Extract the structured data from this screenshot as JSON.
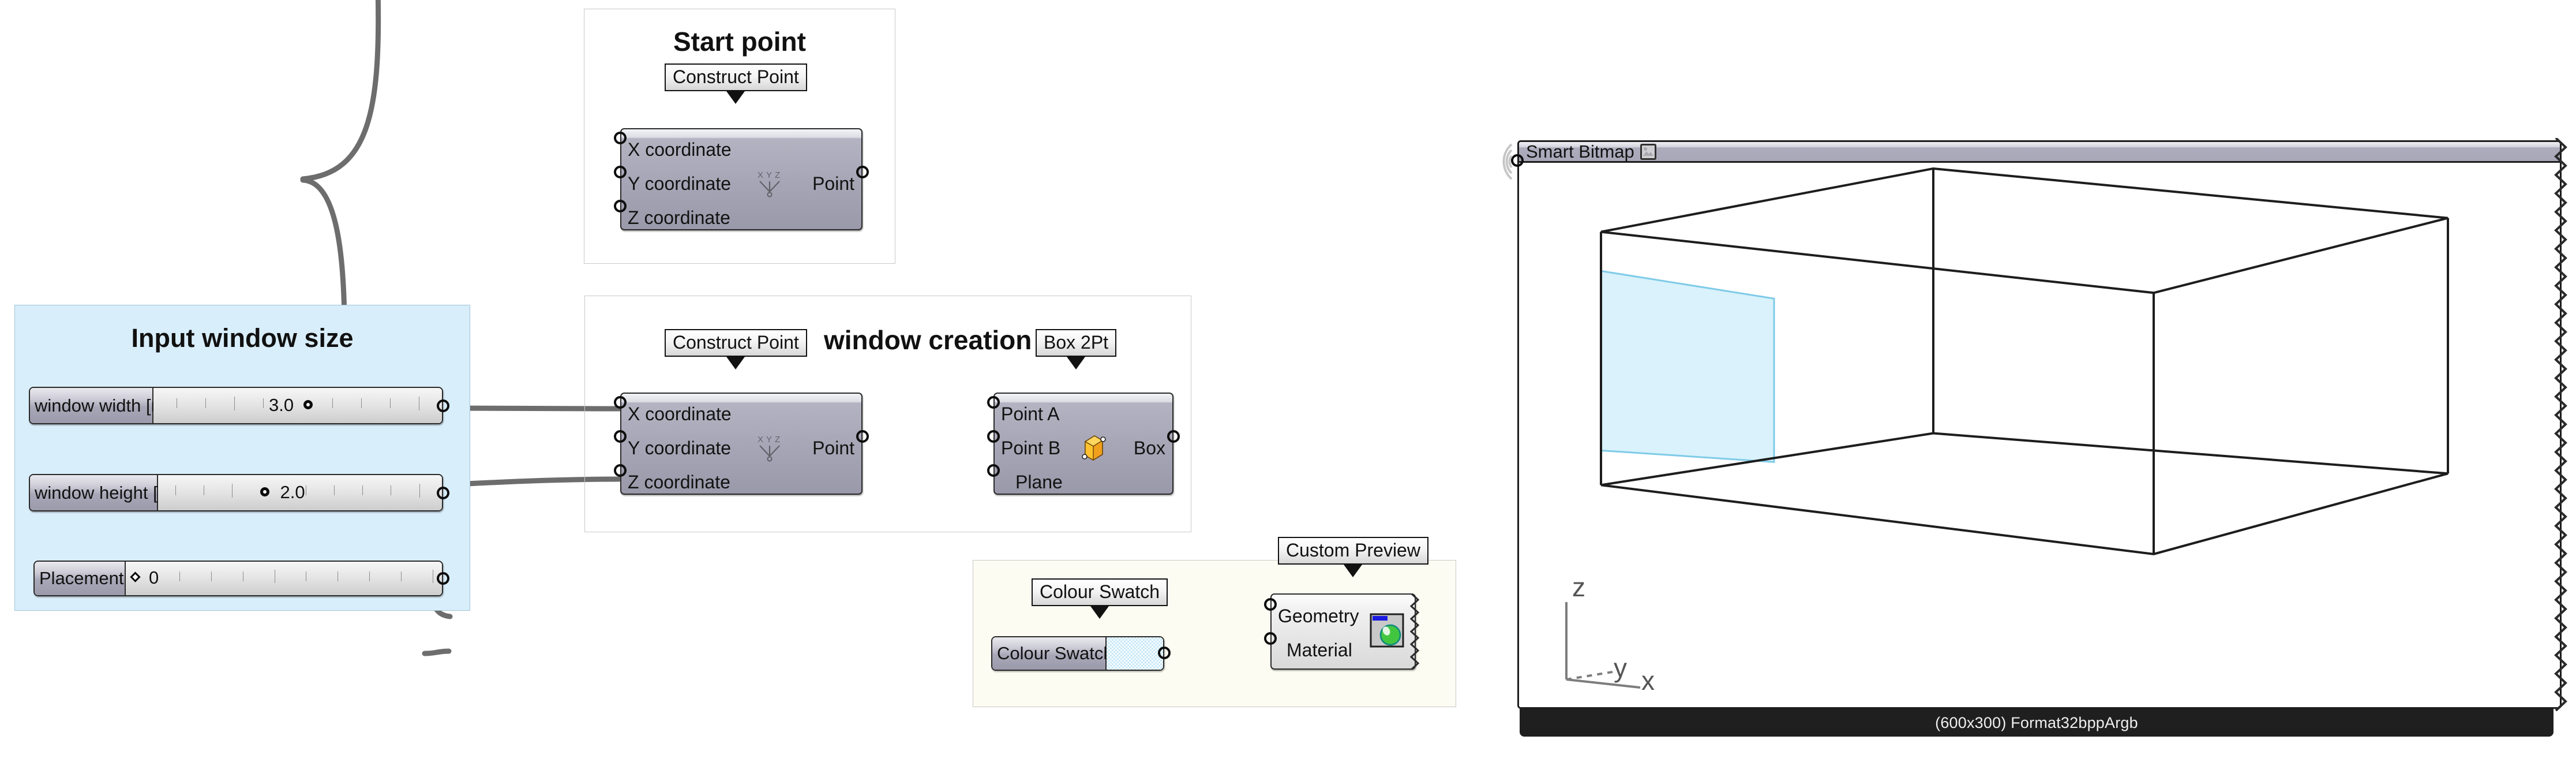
{
  "groups": [
    {
      "name": "input-window-size-group",
      "title": "Input window size",
      "color": "#d9eefb"
    },
    {
      "name": "start-point-group",
      "title": "Start point",
      "color": "#ffffff"
    },
    {
      "name": "window-creation-group",
      "title": "window creation",
      "color": "#ffffff"
    },
    {
      "name": "colour-swatch-group",
      "title": "",
      "color": "#fdfcf3"
    }
  ],
  "sliders": [
    {
      "label": "window width [m]",
      "value": "3.0",
      "knob_pct": 52,
      "handle": "circle"
    },
    {
      "label": "window height [m]",
      "value": "2.0",
      "knob_pct": 37,
      "handle": "circle"
    },
    {
      "label": "Placement",
      "value": "0",
      "knob_pct": 3,
      "handle": "diamond"
    }
  ],
  "colour_swatch": {
    "balloon": "Colour Swatch",
    "label": "Colour Swatch",
    "color": "#c8e9f7"
  },
  "nodes": {
    "start_point": {
      "balloon": "Construct Point",
      "inputs": [
        "X coordinate",
        "Y coordinate",
        "Z coordinate"
      ],
      "outputs": [
        "Point"
      ],
      "icon": "xyz-point-icon"
    },
    "construct_point": {
      "balloon": "Construct Point",
      "inputs": [
        "X coordinate",
        "Y coordinate",
        "Z coordinate"
      ],
      "outputs": [
        "Point"
      ],
      "icon": "xyz-point-icon"
    },
    "box_2pt": {
      "balloon": "Box 2Pt",
      "inputs": [
        "Point A",
        "Point B",
        "Plane"
      ],
      "outputs": [
        "Box"
      ],
      "icon": "orange-box-icon"
    },
    "custom_preview": {
      "balloon": "Custom Preview",
      "inputs": [
        "Geometry",
        "Material"
      ],
      "outputs": [],
      "icon": "preview-sphere-icon"
    }
  },
  "bitmap_viewer": {
    "title": "Smart Bitmap",
    "icon": "image-thumbnail-icon",
    "status": "(600x300) Format32bppArgb"
  },
  "viewport_axes": {
    "z": "z",
    "y": "y",
    "x": "x"
  },
  "colors": {
    "node_body": "#a6a5b5",
    "node_border": "#2a2a2a",
    "wire": "#6d6d6d",
    "group_blue": "#d9eefb",
    "group_cream": "#fdfcf3",
    "window_panel": "#d3f0fa",
    "window_panel_edge": "#76c8ea",
    "status_bar": "#1f1f20"
  }
}
